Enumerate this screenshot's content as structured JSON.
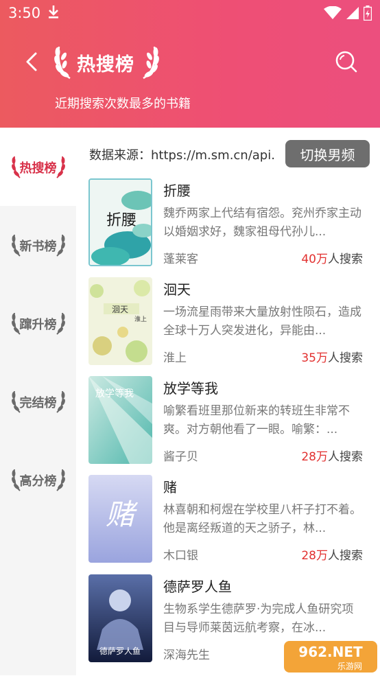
{
  "status_bar": {
    "time": "3:50"
  },
  "header": {
    "title": "热搜榜",
    "subtitle": "近期搜索次数最多的书籍"
  },
  "sidebar": {
    "items": [
      {
        "label": "热搜榜",
        "active": true
      },
      {
        "label": "新书榜"
      },
      {
        "label": "蹿升榜"
      },
      {
        "label": "完结榜"
      },
      {
        "label": "高分榜"
      }
    ]
  },
  "source": {
    "text": "数据来源：https://m.sm.cn/api..."
  },
  "switch_button": {
    "label": "切换男频"
  },
  "books": [
    {
      "title": "折腰",
      "desc": "魏乔两家上代结有宿怨。兖州乔家主动以婚姻求好，魏家祖母代孙儿...",
      "author": "蓬莱客",
      "count_num": "40万",
      "count_suffix": "人搜索",
      "cover_text": "折腰",
      "cover_colors": [
        "#e8f3ee",
        "#2a9fb0"
      ]
    },
    {
      "title": "洄天",
      "desc": "一场流星雨带来大量放射性陨石，造成全球十万人突发进化，异能由...",
      "author": "淮上",
      "count_num": "35万",
      "count_suffix": "人搜索",
      "cover_text": "洄天",
      "cover_sub": "淮上",
      "cover_colors": [
        "#eef2d8",
        "#b8d27a"
      ]
    },
    {
      "title": "放学等我",
      "desc": "喻繁看班里那位新来的转班生非常不爽。对方朝他看了一眼。喻繁：...",
      "author": "酱子贝",
      "count_num": "28万",
      "count_suffix": "人搜索",
      "cover_text": "放学等我",
      "cover_colors": [
        "#d9efe9",
        "#5bbfb3"
      ]
    },
    {
      "title": "赌",
      "desc": "林喜朝和柯煜在学校里八杆子打不着。他是离经叛道的天之骄子，林...",
      "author": "木口银",
      "count_num": "28万",
      "count_suffix": "人搜索",
      "cover_text": "赌",
      "cover_colors": [
        "#c9cdef",
        "#8e9ad6"
      ]
    },
    {
      "title": "德萨罗人鱼",
      "desc": "生物系学生德萨罗·为完成人鱼研究项目与导师莱茵远航考察，在冰...",
      "author": "深海先生",
      "count_num": "",
      "count_suffix": "",
      "cover_text": "德萨罗人鱼",
      "cover_colors": [
        "#3a4f86",
        "#0f1a3a"
      ]
    }
  ],
  "watermark": {
    "text": "962.NET",
    "sub": "乐游网"
  }
}
